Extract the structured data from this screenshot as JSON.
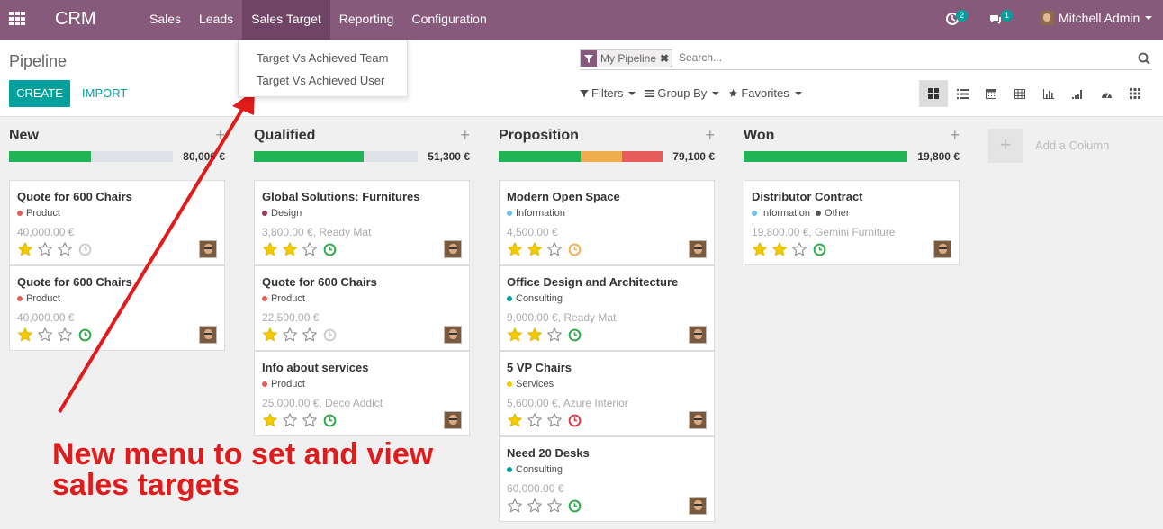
{
  "topbar": {
    "brand": "CRM",
    "menu": [
      "Sales",
      "Leads",
      "Sales Target",
      "Reporting",
      "Configuration"
    ],
    "activity_count": "2",
    "message_count": "1",
    "user_name": "Mitchell Admin"
  },
  "dropdown": {
    "items": [
      "Target Vs Achieved Team",
      "Target Vs Achieved User"
    ]
  },
  "control": {
    "breadcrumb": "Pipeline",
    "create_label": "CREATE",
    "import_label": "IMPORT",
    "facet_value": "My Pipeline",
    "facet_close": "✖",
    "search_placeholder": "Search...",
    "filters_label": "Filters",
    "groupby_label": "Group By",
    "favorites_label": "Favorites"
  },
  "colors": {
    "brand": "#875a7b",
    "accent": "#00a09d",
    "progress_green": "#21b356",
    "progress_orange": "#f0ad4e",
    "progress_red": "#e65c5c",
    "star": "#f3cc00"
  },
  "columns": [
    {
      "title": "New",
      "total": "80,000 €",
      "progress": [
        {
          "color": "#21b356",
          "fraction": 0.5
        }
      ],
      "cards": [
        {
          "title": "Quote for 600 Chairs",
          "tags": [
            {
              "name": "Product",
              "color": "#e65c5c"
            }
          ],
          "amount": "40,000.00 €",
          "stars": 1,
          "activity": "none"
        },
        {
          "title": "Quote for 600 Chairs",
          "tags": [
            {
              "name": "Product",
              "color": "#e65c5c"
            }
          ],
          "amount": "40,000.00 €",
          "stars": 1,
          "activity": "green"
        }
      ]
    },
    {
      "title": "Qualified",
      "total": "51,300 €",
      "progress": [
        {
          "color": "#21b356",
          "fraction": 0.67
        }
      ],
      "cards": [
        {
          "title": "Global Solutions: Furnitures",
          "tags": [
            {
              "name": "Design",
              "color": "#9b3b5a"
            }
          ],
          "amount": "3,800.00 €, Ready Mat",
          "stars": 2,
          "activity": "green"
        },
        {
          "title": "Quote for 600 Chairs",
          "tags": [
            {
              "name": "Product",
              "color": "#e65c5c"
            }
          ],
          "amount": "22,500.00 €",
          "stars": 1,
          "activity": "none"
        },
        {
          "title": "Info about services",
          "tags": [
            {
              "name": "Product",
              "color": "#e65c5c"
            }
          ],
          "amount": "25,000.00 €, Deco Addict",
          "stars": 1,
          "activity": "green"
        }
      ]
    },
    {
      "title": "Proposition",
      "total": "79,100 €",
      "progress": [
        {
          "color": "#21b356",
          "fraction": 0.5
        },
        {
          "color": "#f0ad4e",
          "fraction": 0.25
        },
        {
          "color": "#e65c5c",
          "fraction": 0.25
        }
      ],
      "cards": [
        {
          "title": "Modern Open Space",
          "tags": [
            {
              "name": "Information",
              "color": "#6cc1ed"
            }
          ],
          "amount": "4,500.00 €",
          "stars": 2,
          "activity": "orange"
        },
        {
          "title": "Office Design and Architecture",
          "tags": [
            {
              "name": "Consulting",
              "color": "#00a09d"
            }
          ],
          "amount": "9,000.00 €, Ready Mat",
          "stars": 2,
          "activity": "green"
        },
        {
          "title": "5 VP Chairs",
          "tags": [
            {
              "name": "Services",
              "color": "#f3cc00"
            }
          ],
          "amount": "5,600.00 €, Azure Interior",
          "stars": 1,
          "activity": "red"
        },
        {
          "title": "Need 20 Desks",
          "tags": [
            {
              "name": "Consulting",
              "color": "#00a09d"
            }
          ],
          "amount": "60,000.00 €",
          "stars": 0,
          "activity": "green"
        }
      ]
    },
    {
      "title": "Won",
      "total": "19,800 €",
      "progress": [
        {
          "color": "#21b356",
          "fraction": 1.0
        }
      ],
      "cards": [
        {
          "title": "Distributor Contract",
          "tags": [
            {
              "name": "Information",
              "color": "#6cc1ed"
            },
            {
              "name": "Other",
              "color": "#555555"
            }
          ],
          "amount": "19,800.00 €, Gemini Furniture",
          "stars": 2,
          "activity": "green"
        }
      ]
    }
  ],
  "add_column": {
    "plus": "+",
    "label": "Add a Column"
  },
  "annotation": {
    "line1": "New menu to set and view",
    "line2": "sales targets"
  }
}
